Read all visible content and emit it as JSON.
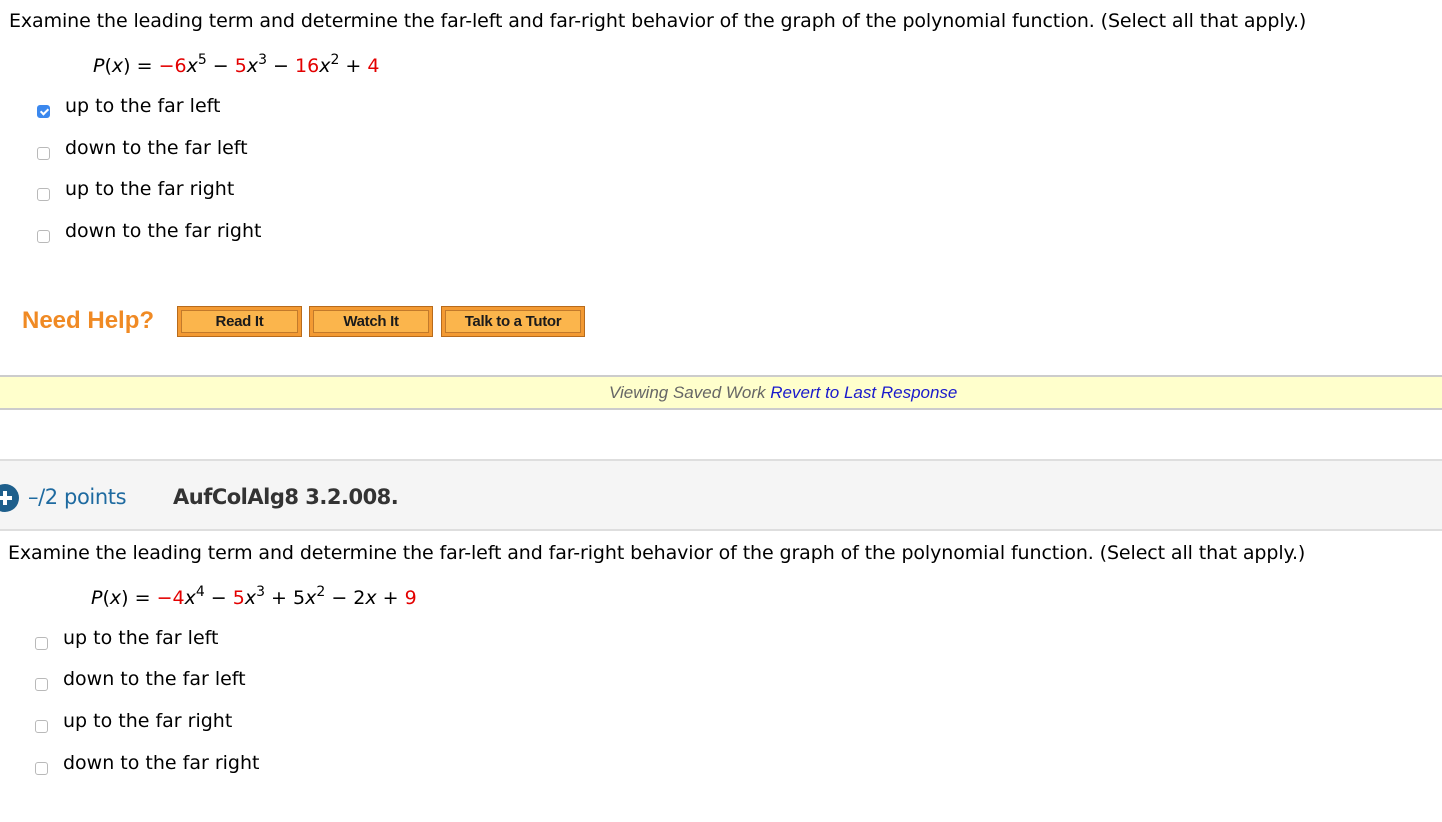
{
  "questions": [
    {
      "prompt": "Examine the leading term and determine the far-left and far-right behavior of the graph of the polynomial function. (Select all that apply.)",
      "formula": {
        "lhs_fn": "P",
        "lhs_var": "x",
        "eq": " = ",
        "terms": [
          {
            "sign": "−",
            "coef": "6",
            "var": "x",
            "exp": "5",
            "sign_red": true,
            "coef_red": true
          },
          {
            "sign": " − ",
            "coef": "5",
            "var": "x",
            "exp": "3",
            "sign_red": false,
            "coef_red": true
          },
          {
            "sign": " − ",
            "coef": "16",
            "var": "x",
            "exp": "2",
            "sign_red": false,
            "coef_red": true
          },
          {
            "sign": " + ",
            "coef": "4",
            "var": "",
            "exp": "",
            "sign_red": false,
            "coef_red": true
          }
        ]
      },
      "choices": [
        {
          "label": "up to the far left",
          "checked": true
        },
        {
          "label": "down to the far left",
          "checked": false
        },
        {
          "label": "up to the far right",
          "checked": false
        },
        {
          "label": "down to the far right",
          "checked": false
        }
      ]
    },
    {
      "prompt": "Examine the leading term and determine the far-left and far-right behavior of the graph of the polynomial function. (Select all that apply.)",
      "formula": {
        "lhs_fn": "P",
        "lhs_var": "x",
        "eq": " = ",
        "terms": [
          {
            "sign": "−",
            "coef": "4",
            "var": "x",
            "exp": "4",
            "sign_red": true,
            "coef_red": true
          },
          {
            "sign": " − ",
            "coef": "5",
            "var": "x",
            "exp": "3",
            "sign_red": false,
            "coef_red": true
          },
          {
            "sign": " + ",
            "coef": "5",
            "var": "x",
            "exp": "2",
            "sign_red": false,
            "coef_red": false
          },
          {
            "sign": " − ",
            "coef": "2",
            "var": "x",
            "exp": "",
            "sign_red": false,
            "coef_red": false
          },
          {
            "sign": " + ",
            "coef": "9",
            "var": "",
            "exp": "",
            "sign_red": false,
            "coef_red": true
          }
        ]
      },
      "choices": [
        {
          "label": "up to the far left",
          "checked": false
        },
        {
          "label": "down to the far left",
          "checked": false
        },
        {
          "label": "up to the far right",
          "checked": false
        },
        {
          "label": "down to the far right",
          "checked": false
        }
      ]
    }
  ],
  "help": {
    "title": "Need Help?",
    "buttons": [
      "Read It",
      "Watch It",
      "Talk to a Tutor"
    ]
  },
  "saved_bar": {
    "status": "Viewing Saved Work",
    "link": "Revert to Last Response"
  },
  "question_header": {
    "expand_icon": "plus-circle-icon",
    "points": "–/2 points",
    "id": "AufColAlg8 3.2.008."
  },
  "colors": {
    "red": "#e30000",
    "checkbox_checked": "#3b88ee",
    "need_help": "#f08a24",
    "button_fill": "#fbb54c",
    "link_blue": "#1a1acc",
    "points_blue": "#1e6aa0",
    "saved_bar_bg": "#ffffcc"
  }
}
